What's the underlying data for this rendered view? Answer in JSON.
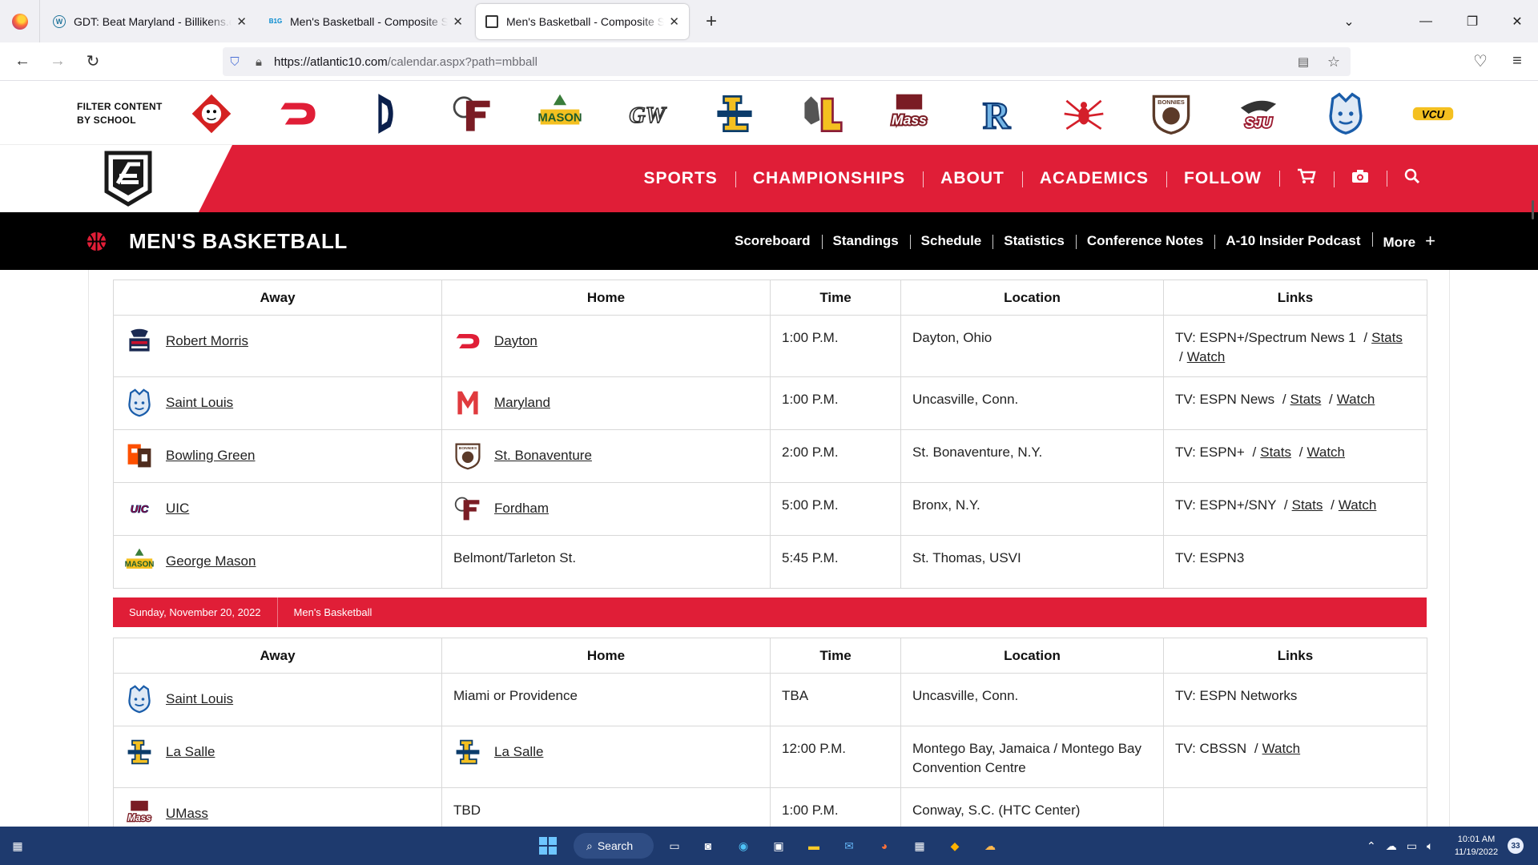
{
  "browser": {
    "tabs": [
      {
        "label": "GDT: Beat Maryland - Billikens.com",
        "active": false,
        "favicon": "wordpress-icon"
      },
      {
        "label": "Men's Basketball - Composite Schedule",
        "active": false,
        "favicon": "big-ten-icon"
      },
      {
        "label": "Men's Basketball - Composite Schedule",
        "active": true,
        "favicon": "a10-icon"
      }
    ],
    "url_host": "https://atlantic10.com",
    "url_path": "/calendar.aspx?path=mbball"
  },
  "filter": {
    "label_line1": "FILTER CONTENT",
    "label_line2": "BY SCHOOL",
    "schools": [
      {
        "name": "Davidson",
        "icon": "davidson-wildcat-icon",
        "color": "#d42121"
      },
      {
        "name": "Dayton",
        "icon": "dayton-d-icon",
        "color": "#e01e37",
        "text": "D"
      },
      {
        "name": "Duquesne",
        "icon": "duquesne-d-icon",
        "color": "#0a1f4b"
      },
      {
        "name": "Fordham",
        "icon": "fordham-ram-icon",
        "color": "#7a1c24",
        "text": "F"
      },
      {
        "name": "George Mason",
        "icon": "george-mason-patriot-icon",
        "color": "#3a7d3a",
        "text": "MASON"
      },
      {
        "name": "George Washington",
        "icon": "gw-icon",
        "color": "#b49a5a",
        "text": "GW"
      },
      {
        "name": "La Salle",
        "icon": "la-salle-l-icon",
        "color": "#0b3c6b",
        "text": "L"
      },
      {
        "name": "Loyola Chicago",
        "icon": "loyola-wolf-icon",
        "color": "#8a1d36",
        "text": "L"
      },
      {
        "name": "UMass",
        "icon": "umass-icon",
        "color": "#7a1c24",
        "text": "Mass"
      },
      {
        "name": "Rhode Island",
        "icon": "rhode-island-r-icon",
        "color": "#0f3c78",
        "text": "R"
      },
      {
        "name": "Richmond",
        "icon": "richmond-spider-icon",
        "color": "#d41f2a"
      },
      {
        "name": "St. Bonaventure",
        "icon": "bonnies-icon",
        "color": "#5b3a29",
        "text": "BONNIES"
      },
      {
        "name": "Saint Joseph's",
        "icon": "sju-hawk-icon",
        "color": "#9b1b30",
        "text": "SJU"
      },
      {
        "name": "Saint Louis",
        "icon": "billiken-icon",
        "color": "#1a5daa"
      },
      {
        "name": "VCU",
        "icon": "vcu-icon",
        "color": "#000000",
        "text": "VCU"
      }
    ]
  },
  "header": {
    "nav": [
      "SPORTS",
      "CHAMPIONSHIPS",
      "ABOUT",
      "ACADEMICS",
      "FOLLOW"
    ],
    "accent": "#e01e37"
  },
  "sport": {
    "title": "MEN'S BASKETBALL",
    "subnav": [
      "Scoreboard",
      "Standings",
      "Schedule",
      "Statistics",
      "Conference Notes",
      "A-10 Insider Podcast",
      "More"
    ]
  },
  "table_headers": [
    "Away",
    "Home",
    "Time",
    "Location",
    "Links"
  ],
  "games_day1": [
    {
      "away": "Robert Morris",
      "away_icon": "robert-morris-icon",
      "home": "Dayton",
      "home_icon": "dayton-d-icon",
      "time": "1:00 P.M.",
      "location": "Dayton, Ohio",
      "tv": "TV: ESPN+/Spectrum News 1",
      "stats": "Stats",
      "watch": "Watch"
    },
    {
      "away": "Saint Louis",
      "away_icon": "billiken-icon",
      "home": "Maryland",
      "home_icon": "maryland-m-icon",
      "time": "1:00 P.M.",
      "location": "Uncasville, Conn.",
      "tv": "TV: ESPN News",
      "stats": "Stats",
      "watch": "Watch"
    },
    {
      "away": "Bowling Green",
      "away_icon": "bowling-green-icon",
      "home": "St. Bonaventure",
      "home_icon": "bonnies-icon",
      "time": "2:00 P.M.",
      "location": "St. Bonaventure, N.Y.",
      "tv": "TV: ESPN+",
      "stats": "Stats",
      "watch": "Watch"
    },
    {
      "away": "UIC",
      "away_icon": "uic-icon",
      "home": "Fordham",
      "home_icon": "fordham-ram-icon",
      "time": "5:00 P.M.",
      "location": "Bronx, N.Y.",
      "tv": "TV: ESPN+/SNY",
      "stats": "Stats",
      "watch": "Watch"
    },
    {
      "away": "George Mason",
      "away_icon": "george-mason-patriot-icon",
      "home": "Belmont/Tarleton St.",
      "time": "5:45 P.M.",
      "location": "St. Thomas, USVI",
      "tv": "TV: ESPN3"
    }
  ],
  "date_band": {
    "date": "Sunday, November 20, 2022",
    "sport": "Men's Basketball"
  },
  "games_day2": [
    {
      "away": "Saint Louis",
      "away_icon": "billiken-icon",
      "home": "Miami or Providence",
      "time": "TBA",
      "location": "Uncasville, Conn.",
      "tv": "TV: ESPN Networks"
    },
    {
      "away": "La Salle",
      "away_icon": "la-salle-l-icon",
      "home": "La Salle",
      "home_icon": "la-salle-l-icon",
      "time": "12:00 P.M.",
      "location": "Montego Bay, Jamaica / Montego Bay Convention Centre",
      "tv": "TV: CBSSN",
      "watch": "Watch"
    },
    {
      "away": "UMass",
      "away_icon": "umass-icon",
      "home": "TBD",
      "time": "1:00 P.M.",
      "location": "Conway, S.C. (HTC Center)",
      "tv": ""
    }
  ],
  "taskbar": {
    "search_label": "Search",
    "time": "10:01 AM",
    "date": "11/19/2022",
    "notifications": "33"
  }
}
